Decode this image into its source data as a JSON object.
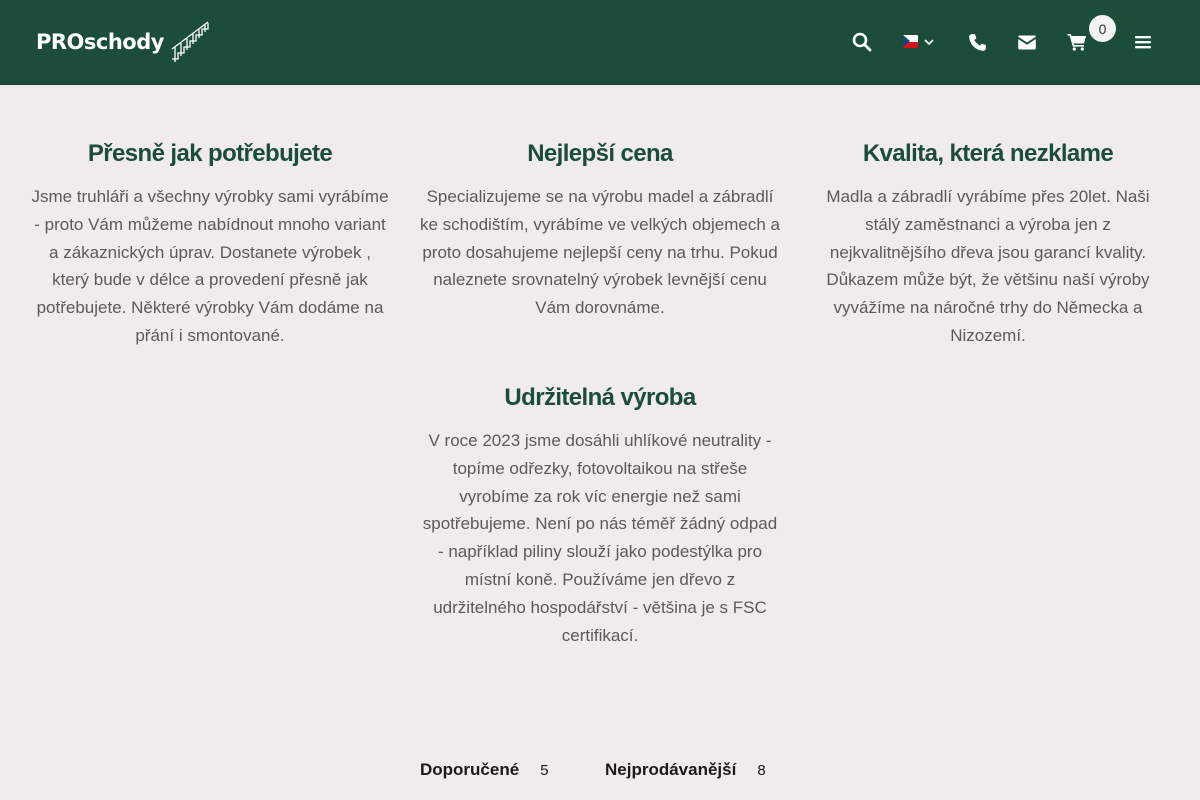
{
  "header": {
    "logo_text": "PROschody",
    "cart_count": "0",
    "colors": {
      "background": "#1b4d38",
      "accent_text": "#1b4d38"
    },
    "icons": [
      "search-icon",
      "flag-cz-icon",
      "chevron-down-icon",
      "phone-icon",
      "envelope-icon",
      "cart-icon",
      "hamburger-menu-icon"
    ]
  },
  "features": [
    {
      "title": "Přesně jak potřebujete",
      "text": "Jsme truhláři a všechny výrobky sami vyrábíme - proto Vám můžeme nabídnout mnoho variant a zákaznických úprav. Dostanete výrobek , který bude v délce a provedení přesně jak potřebujete. Některé výrobky Vám dodáme na přání i smontované."
    },
    {
      "title": "Nejlepší cena",
      "text": "Specializujeme se na výrobu madel a zábradlí ke schodištím, vyrábíme ve velkých objemech a proto dosahujeme nejlepší ceny na trhu. Pokud naleznete srovnatelný výrobek levnější cenu Vám dorovnáme."
    },
    {
      "title": "Kvalita, která nezklame",
      "text": "Madla a zábradlí vyrábíme přes 20let. Naši stálý zaměstnanci a výroba jen z nejkvalitnějšího dřeva jsou garancí kvality. Důkazem může být, že většinu naší výroby vyvážíme na náročné trhy do Německa a Nizozemí."
    },
    {
      "title": "Udržitelná výroba",
      "text": "V roce 2023 jsme dosáhli uhlíkové neutrality - topíme odřezky, fotovoltaikou na střeše vyrobíme za rok víc energie než sami spotřebujeme. Není po nás téměř žádný odpad - například piliny slouží jako podestýlka pro místní koně. Používáme jen dřevo z udržitelného hospodářství - většina je s FSC certifikací."
    }
  ],
  "product_tabs": [
    {
      "label": "Doporučené",
      "count": "5"
    },
    {
      "label": "Nejprodávanější",
      "count": "8"
    }
  ]
}
